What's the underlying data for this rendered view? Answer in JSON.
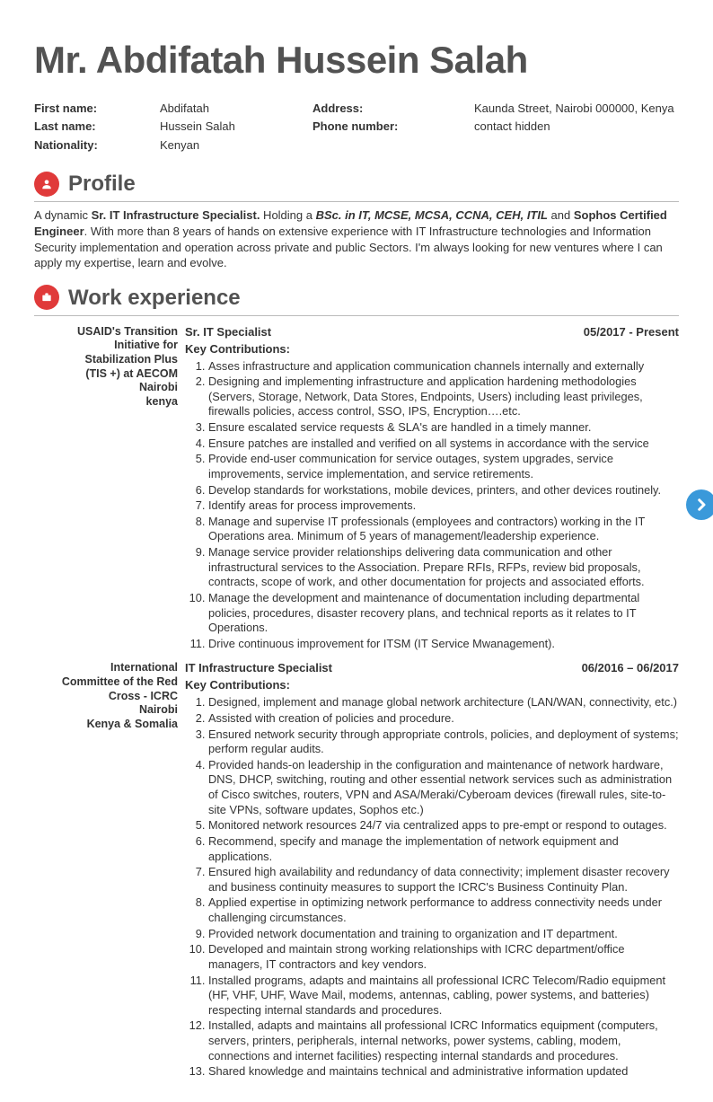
{
  "title": "Mr. Abdifatah Hussein Salah",
  "info": {
    "first_name_label": "First name:",
    "first_name": "Abdifatah",
    "last_name_label": "Last name:",
    "last_name": "Hussein Salah",
    "nationality_label": "Nationality:",
    "nationality": "Kenyan",
    "address_label": "Address:",
    "address": "Kaunda Street, Nairobi 000000, Kenya",
    "phone_label": "Phone number:",
    "phone": "contact hidden"
  },
  "sections": {
    "profile_title": "Profile",
    "work_title": "Work experience"
  },
  "profile": {
    "pre": "A dynamic ",
    "role": "Sr. IT Infrastructure Specialist.",
    "mid1": " Holding a ",
    "creds": "BSc. in IT, MCSE, MCSA, CCNA, CEH, ITIL",
    "mid2": " and ",
    "cert": "Sophos Certified Engineer",
    "rest": ". With more than 8 years of hands on extensive experience with IT Infrastructure technologies and Information Security implementation and operation across private and public Sectors. I'm always looking for new ventures where I can apply my expertise, learn and evolve."
  },
  "jobs": [
    {
      "org_lines": [
        "USAID's Transition",
        "Initiative for",
        "Stabilization Plus",
        "(TIS +) at AECOM",
        "Nairobi",
        "kenya"
      ],
      "title": "Sr. IT Specialist",
      "dates": "05/2017 - Present",
      "subhead": "Key Contributions:",
      "contributions": [
        "Asses infrastructure and application communication channels internally and externally",
        "Designing and implementing infrastructure and application hardening methodologies (Servers, Storage, Network, Data Stores, Endpoints, Users) including least privileges, firewalls policies, access control, SSO, IPS, Encryption….etc.",
        "Ensure escalated service requests & SLA's are handled in a timely manner.",
        "Ensure patches are installed and verified on all systems in accordance with the service",
        "Provide end-user communication for service outages, system upgrades, service improvements, service implementation, and service retirements.",
        "Develop standards for workstations, mobile devices, printers, and other devices routinely.",
        "Identify areas for process improvements.",
        "Manage and supervise IT professionals (employees and contractors) working in the IT Operations area.  Minimum of 5 years of management/leadership experience.",
        "Manage service provider relationships delivering data communication and other infrastructural services to the Association. Prepare RFIs, RFPs, review bid proposals, contracts, scope of work, and other documentation for projects and associated efforts.",
        "Manage the development and maintenance of documentation including departmental policies, procedures, disaster recovery plans, and technical reports as it relates to IT Operations.",
        "Drive continuous improvement for ITSM (IT Service Mwanagement)."
      ]
    },
    {
      "org_lines": [
        "International",
        "Committee of the Red",
        "Cross - ICRC",
        "Nairobi",
        "Kenya & Somalia"
      ],
      "title": "IT Infrastructure Specialist",
      "dates": "06/2016 – 06/2017",
      "subhead": "Key Contributions:",
      "contributions": [
        "Designed, implement and manage global network architecture (LAN/WAN, connectivity, etc.)",
        "Assisted with creation of policies and procedure.",
        "Ensured network security through appropriate controls, policies, and deployment of systems; perform regular audits.",
        "Provided hands-on leadership in the configuration and maintenance of network hardware, DNS, DHCP, switching, routing and other essential network services such as administration of Cisco switches, routers, VPN and ASA/Meraki/Cyberoam devices (firewall rules, site-to-site VPNs, software updates, Sophos etc.)",
        "Monitored network resources 24/7 via centralized apps to pre-empt or respond to outages.",
        "Recommend, specify and manage the implementation of network equipment and applications.",
        "Ensured high availability and redundancy of data connectivity; implement disaster recovery and business continuity measures to support the ICRC's Business Continuity Plan.",
        "Applied expertise in optimizing network performance to address connectivity needs under challenging circumstances.",
        "Provided network documentation and training to organization and IT department.",
        "Developed and maintain strong working relationships with ICRC department/office managers, IT contractors and key vendors.",
        "Installed programs, adapts and maintains all professional ICRC Telecom/Radio equipment (HF, VHF, UHF, Wave Mail, modems, antennas, cabling, power systems, and batteries) respecting internal standards and procedures.",
        "Installed, adapts and maintains all professional ICRC Informatics equipment (computers, servers, printers, peripherals, internal networks, power systems, cabling, modem, connections and internet facilities) respecting internal standards and procedures.",
        "Shared knowledge and maintains technical and administrative information updated"
      ]
    }
  ]
}
